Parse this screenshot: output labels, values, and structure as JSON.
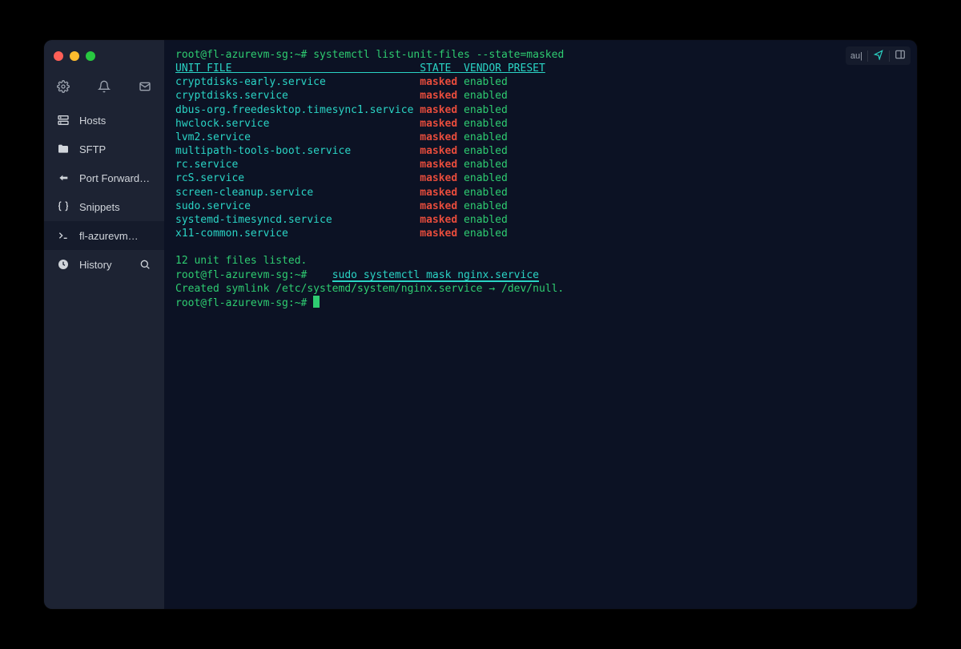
{
  "sidebar": {
    "items": [
      {
        "label": "Hosts"
      },
      {
        "label": "SFTP"
      },
      {
        "label": "Port Forwarding"
      },
      {
        "label": "Snippets"
      },
      {
        "label": "fl-azurevm…"
      },
      {
        "label": "History"
      }
    ]
  },
  "toolbar": {
    "auto": "au|"
  },
  "terminal": {
    "prompt": "root@fl-azurevm-sg:~#",
    "cmd1": "systemctl list-unit-files --state=masked",
    "headers": {
      "unit": "UNIT FILE",
      "state": "STATE",
      "preset": "VENDOR PRESET"
    },
    "rows": [
      {
        "unit": "cryptdisks-early.service",
        "state": "masked",
        "preset": "enabled"
      },
      {
        "unit": "cryptdisks.service",
        "state": "masked",
        "preset": "enabled"
      },
      {
        "unit": "dbus-org.freedesktop.timesync1.service",
        "state": "masked",
        "preset": "enabled"
      },
      {
        "unit": "hwclock.service",
        "state": "masked",
        "preset": "enabled"
      },
      {
        "unit": "lvm2.service",
        "state": "masked",
        "preset": "enabled"
      },
      {
        "unit": "multipath-tools-boot.service",
        "state": "masked",
        "preset": "enabled"
      },
      {
        "unit": "rc.service",
        "state": "masked",
        "preset": "enabled"
      },
      {
        "unit": "rcS.service",
        "state": "masked",
        "preset": "enabled"
      },
      {
        "unit": "screen-cleanup.service",
        "state": "masked",
        "preset": "enabled"
      },
      {
        "unit": "sudo.service",
        "state": "masked",
        "preset": "enabled"
      },
      {
        "unit": "systemd-timesyncd.service",
        "state": "masked",
        "preset": "enabled"
      },
      {
        "unit": "x11-common.service",
        "state": "masked",
        "preset": "enabled"
      }
    ],
    "summary": "12 unit files listed.",
    "cmd2": "sudo systemctl mask nginx.service",
    "result": "Created symlink /etc/systemd/system/nginx.service → /dev/null."
  }
}
